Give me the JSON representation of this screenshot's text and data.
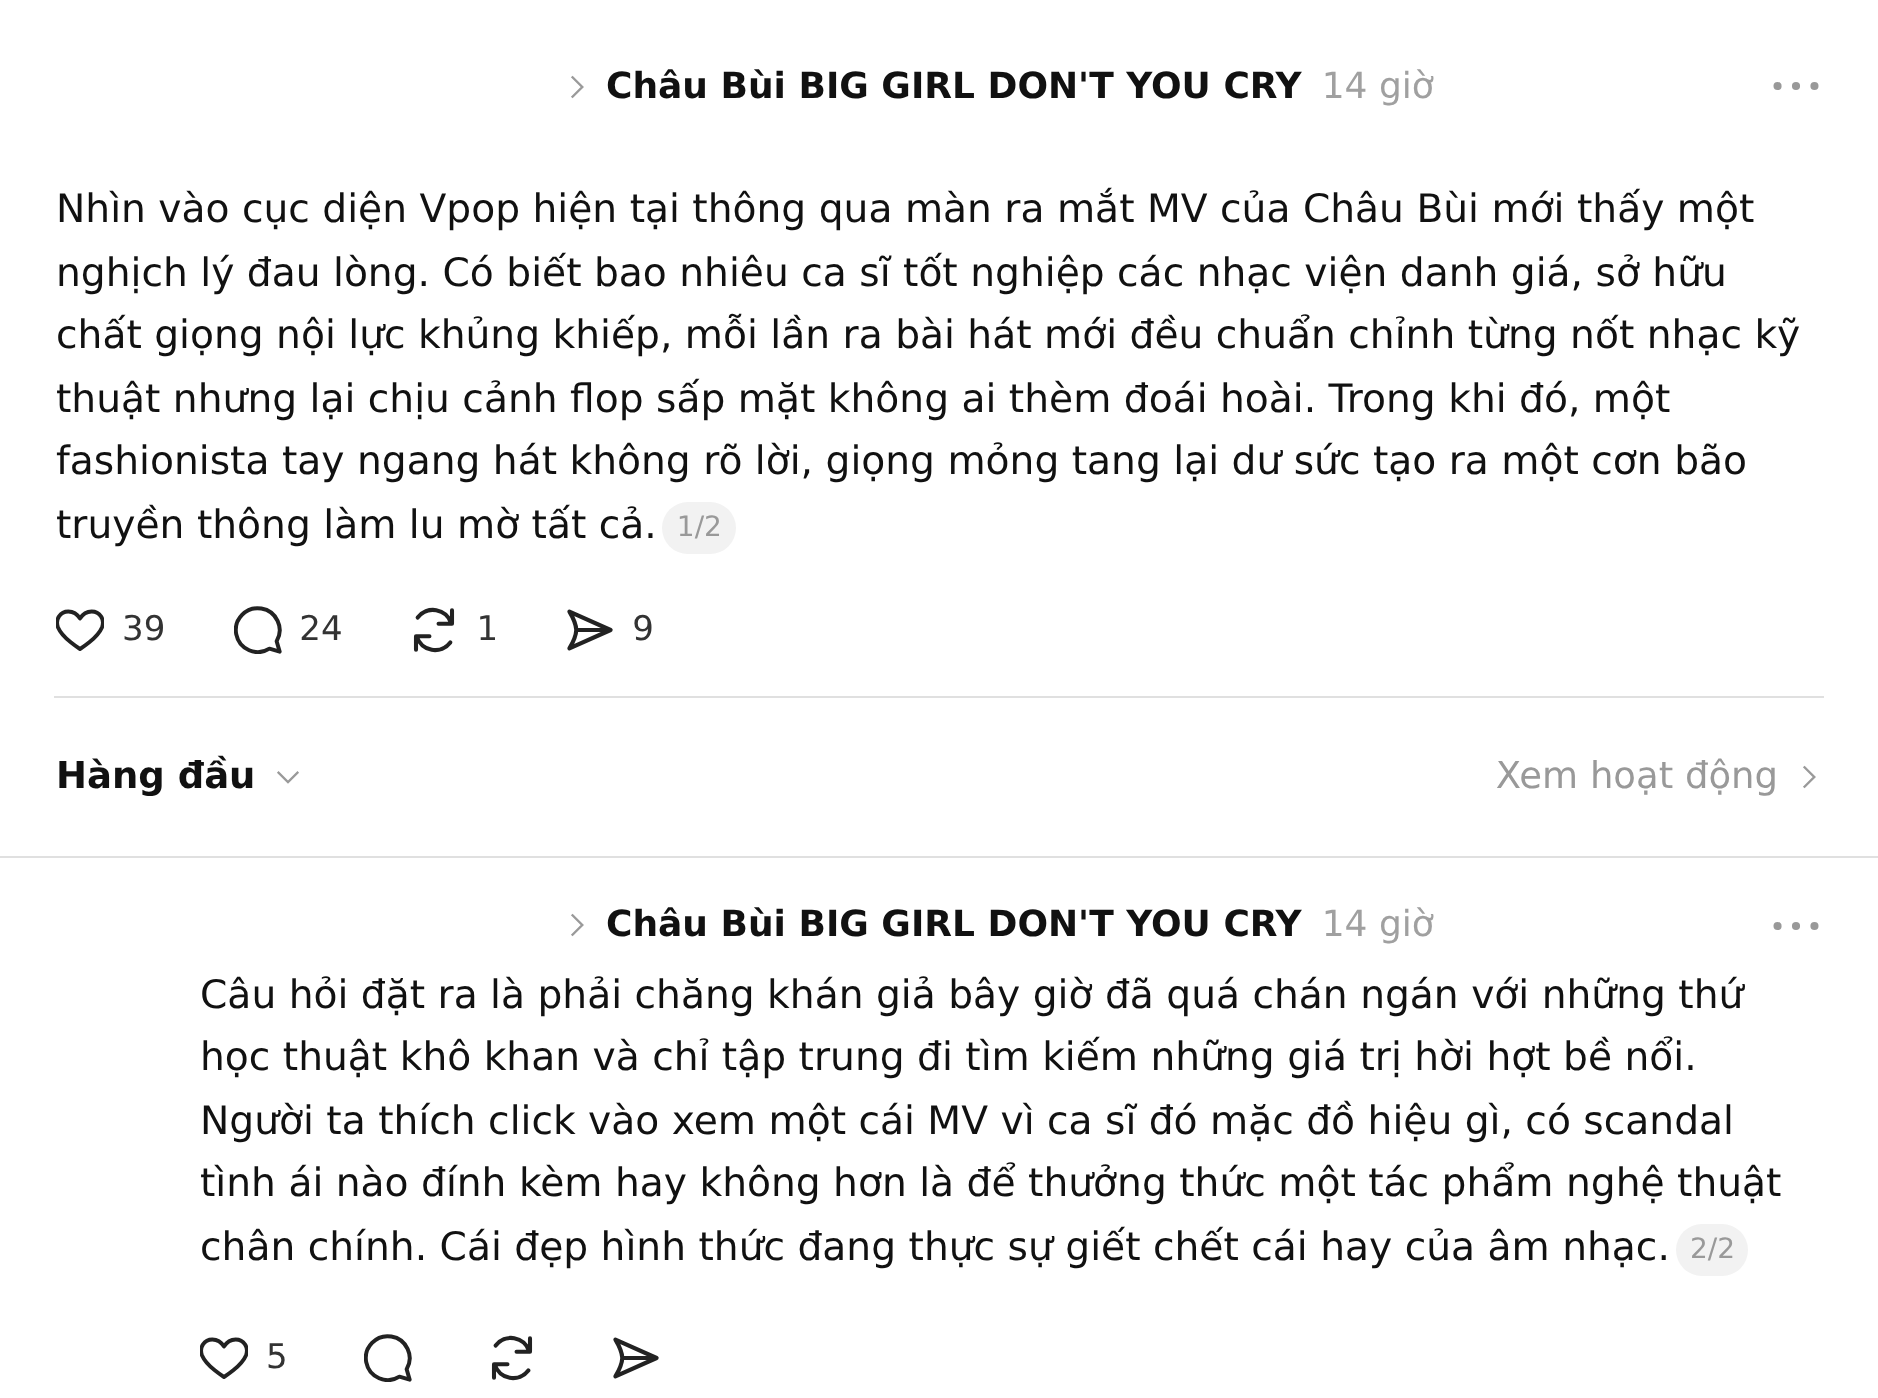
{
  "post": {
    "topic": "Châu Bùi BIG GIRL DON'T YOU CRY",
    "time": "14 giờ",
    "body": "Nhìn vào cục diện Vpop hiện tại thông qua màn ra mắt MV của Châu Bùi mới thấy một nghịch lý đau lòng. Có biết bao nhiêu ca sĩ tốt nghiệp các nhạc viện danh giá, sở hữu chất giọng nội lực khủng khiếp, mỗi lần ra bài hát mới đều chuẩn chỉnh từng nốt nhạc kỹ thuật nhưng lại chịu cảnh flop sấp mặt không ai thèm đoái hoài. Trong khi đó, một fashionista tay ngang hát không rõ lời, giọng mỏng tang lại dư sức tạo ra một cơn bão truyền thông làm lu mờ tất cả.",
    "page_badge": "1/2",
    "actions": [
      {
        "kind": "like",
        "count": "39"
      },
      {
        "kind": "reply",
        "count": "24"
      },
      {
        "kind": "repost",
        "count": "1"
      },
      {
        "kind": "share",
        "count": "9"
      }
    ]
  },
  "sort_bar": {
    "label": "Hàng đầu",
    "activity_link": "Xem hoạt động"
  },
  "replies": [
    {
      "topic": "Châu Bùi BIG GIRL DON'T YOU CRY",
      "time": "14 giờ",
      "body": "Câu hỏi đặt ra là phải chăng khán giả bây giờ đã quá chán ngán với những thứ học thuật khô khan và chỉ tập trung đi tìm kiếm những giá trị hời hợt bề nổi. Người ta thích click vào xem một cái MV vì ca sĩ đó mặc đồ hiệu gì, có scandal tình ái nào đính kèm hay không hơn là để thưởng thức một tác phẩm nghệ thuật chân chính. Cái đẹp hình thức đang thực sự giết chết cái hay của âm nhạc.",
      "page_badge": "2/2",
      "actions": [
        {
          "kind": "like",
          "count": "5"
        },
        {
          "kind": "reply"
        },
        {
          "kind": "repost"
        },
        {
          "kind": "share"
        }
      ]
    }
  ]
}
